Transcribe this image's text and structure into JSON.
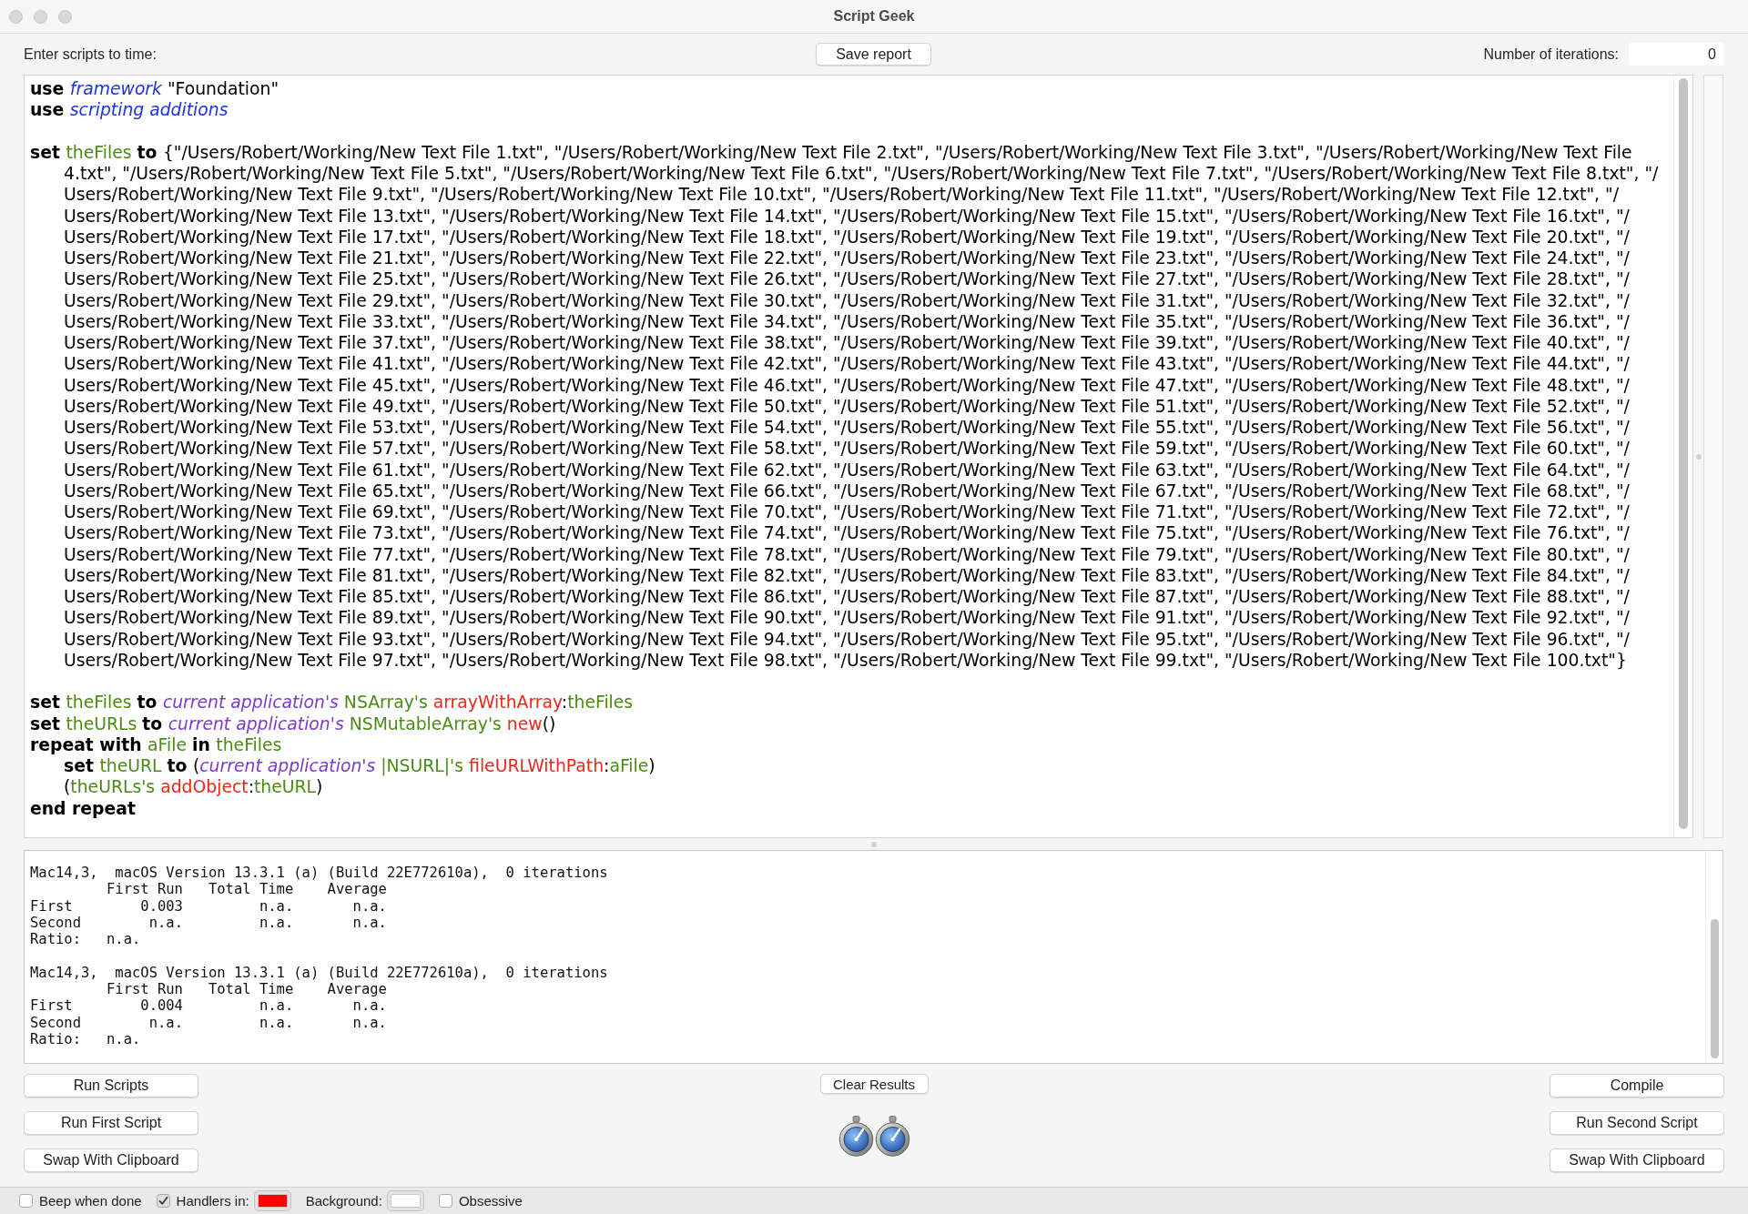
{
  "window": {
    "title": "Script Geek"
  },
  "toolbar": {
    "prompt": "Enter scripts to time:",
    "save_button": "Save report",
    "iterations": {
      "label": "Number of iterations:",
      "value": "0"
    }
  },
  "editor": {
    "lines": [
      {
        "kind": "code",
        "tokens": [
          {
            "kind": "keyword",
            "text": "use "
          },
          {
            "kind": "term",
            "text": "framework "
          },
          {
            "kind": "text",
            "text": "\"Foundation\""
          }
        ]
      },
      {
        "kind": "code",
        "tokens": [
          {
            "kind": "keyword",
            "text": "use "
          },
          {
            "kind": "term",
            "text": "scripting additions"
          }
        ]
      },
      {
        "kind": "blank"
      },
      {
        "kind": "code",
        "tokens": [
          {
            "kind": "keyword",
            "text": "set "
          },
          {
            "kind": "variable",
            "text": "theFiles "
          },
          {
            "kind": "keyword",
            "text": "to "
          },
          {
            "kind": "text",
            "text": "{\"/Users/Robert/Working/New Text File 1.txt\", \"/Users/Robert/Working/New Text File 2.txt\", \"/Users/Robert/Working/New Text File 3.txt\", \"/Users/Robert/Working/New Text File"
          }
        ],
        "continuation": [
          "4.txt\", \"/Users/Robert/Working/New Text File 5.txt\", \"/Users/Robert/Working/New Text File 6.txt\", \"/Users/Robert/Working/New Text File 7.txt\", \"/Users/Robert/Working/New Text File 8.txt\", \"/",
          "Users/Robert/Working/New Text File 9.txt\", \"/Users/Robert/Working/New Text File 10.txt\", \"/Users/Robert/Working/New Text File 11.txt\", \"/Users/Robert/Working/New Text File 12.txt\", \"/",
          "Users/Robert/Working/New Text File 13.txt\", \"/Users/Robert/Working/New Text File 14.txt\", \"/Users/Robert/Working/New Text File 15.txt\", \"/Users/Robert/Working/New Text File 16.txt\", \"/",
          "Users/Robert/Working/New Text File 17.txt\", \"/Users/Robert/Working/New Text File 18.txt\", \"/Users/Robert/Working/New Text File 19.txt\", \"/Users/Robert/Working/New Text File 20.txt\", \"/",
          "Users/Robert/Working/New Text File 21.txt\", \"/Users/Robert/Working/New Text File 22.txt\", \"/Users/Robert/Working/New Text File 23.txt\", \"/Users/Robert/Working/New Text File 24.txt\", \"/",
          "Users/Robert/Working/New Text File 25.txt\", \"/Users/Robert/Working/New Text File 26.txt\", \"/Users/Robert/Working/New Text File 27.txt\", \"/Users/Robert/Working/New Text File 28.txt\", \"/",
          "Users/Robert/Working/New Text File 29.txt\", \"/Users/Robert/Working/New Text File 30.txt\", \"/Users/Robert/Working/New Text File 31.txt\", \"/Users/Robert/Working/New Text File 32.txt\", \"/",
          "Users/Robert/Working/New Text File 33.txt\", \"/Users/Robert/Working/New Text File 34.txt\", \"/Users/Robert/Working/New Text File 35.txt\", \"/Users/Robert/Working/New Text File 36.txt\", \"/",
          "Users/Robert/Working/New Text File 37.txt\", \"/Users/Robert/Working/New Text File 38.txt\", \"/Users/Robert/Working/New Text File 39.txt\", \"/Users/Robert/Working/New Text File 40.txt\", \"/",
          "Users/Robert/Working/New Text File 41.txt\", \"/Users/Robert/Working/New Text File 42.txt\", \"/Users/Robert/Working/New Text File 43.txt\", \"/Users/Robert/Working/New Text File 44.txt\", \"/",
          "Users/Robert/Working/New Text File 45.txt\", \"/Users/Robert/Working/New Text File 46.txt\", \"/Users/Robert/Working/New Text File 47.txt\", \"/Users/Robert/Working/New Text File 48.txt\", \"/",
          "Users/Robert/Working/New Text File 49.txt\", \"/Users/Robert/Working/New Text File 50.txt\", \"/Users/Robert/Working/New Text File 51.txt\", \"/Users/Robert/Working/New Text File 52.txt\", \"/",
          "Users/Robert/Working/New Text File 53.txt\", \"/Users/Robert/Working/New Text File 54.txt\", \"/Users/Robert/Working/New Text File 55.txt\", \"/Users/Robert/Working/New Text File 56.txt\", \"/",
          "Users/Robert/Working/New Text File 57.txt\", \"/Users/Robert/Working/New Text File 58.txt\", \"/Users/Robert/Working/New Text File 59.txt\", \"/Users/Robert/Working/New Text File 60.txt\", \"/",
          "Users/Robert/Working/New Text File 61.txt\", \"/Users/Robert/Working/New Text File 62.txt\", \"/Users/Robert/Working/New Text File 63.txt\", \"/Users/Robert/Working/New Text File 64.txt\", \"/",
          "Users/Robert/Working/New Text File 65.txt\", \"/Users/Robert/Working/New Text File 66.txt\", \"/Users/Robert/Working/New Text File 67.txt\", \"/Users/Robert/Working/New Text File 68.txt\", \"/",
          "Users/Robert/Working/New Text File 69.txt\", \"/Users/Robert/Working/New Text File 70.txt\", \"/Users/Robert/Working/New Text File 71.txt\", \"/Users/Robert/Working/New Text File 72.txt\", \"/",
          "Users/Robert/Working/New Text File 73.txt\", \"/Users/Robert/Working/New Text File 74.txt\", \"/Users/Robert/Working/New Text File 75.txt\", \"/Users/Robert/Working/New Text File 76.txt\", \"/",
          "Users/Robert/Working/New Text File 77.txt\", \"/Users/Robert/Working/New Text File 78.txt\", \"/Users/Robert/Working/New Text File 79.txt\", \"/Users/Robert/Working/New Text File 80.txt\", \"/",
          "Users/Robert/Working/New Text File 81.txt\", \"/Users/Robert/Working/New Text File 82.txt\", \"/Users/Robert/Working/New Text File 83.txt\", \"/Users/Robert/Working/New Text File 84.txt\", \"/",
          "Users/Robert/Working/New Text File 85.txt\", \"/Users/Robert/Working/New Text File 86.txt\", \"/Users/Robert/Working/New Text File 87.txt\", \"/Users/Robert/Working/New Text File 88.txt\", \"/",
          "Users/Robert/Working/New Text File 89.txt\", \"/Users/Robert/Working/New Text File 90.txt\", \"/Users/Robert/Working/New Text File 91.txt\", \"/Users/Robert/Working/New Text File 92.txt\", \"/",
          "Users/Robert/Working/New Text File 93.txt\", \"/Users/Robert/Working/New Text File 94.txt\", \"/Users/Robert/Working/New Text File 95.txt\", \"/Users/Robert/Working/New Text File 96.txt\", \"/",
          "Users/Robert/Working/New Text File 97.txt\", \"/Users/Robert/Working/New Text File 98.txt\", \"/Users/Robert/Working/New Text File 99.txt\", \"/Users/Robert/Working/New Text File 100.txt\"}"
        ]
      },
      {
        "kind": "blank"
      },
      {
        "kind": "code",
        "tokens": [
          {
            "kind": "keyword",
            "text": "set "
          },
          {
            "kind": "variable",
            "text": "theFiles "
          },
          {
            "kind": "keyword",
            "text": "to "
          },
          {
            "kind": "application",
            "text": "current application's "
          },
          {
            "kind": "variable",
            "text": "NSArray's "
          },
          {
            "kind": "handler",
            "text": "arrayWithArray"
          },
          {
            "kind": "text",
            "text": ":"
          },
          {
            "kind": "variable",
            "text": "theFiles"
          }
        ]
      },
      {
        "kind": "code",
        "tokens": [
          {
            "kind": "keyword",
            "text": "set "
          },
          {
            "kind": "variable",
            "text": "theURLs "
          },
          {
            "kind": "keyword",
            "text": "to "
          },
          {
            "kind": "application",
            "text": "current application's "
          },
          {
            "kind": "variable",
            "text": "NSMutableArray's "
          },
          {
            "kind": "handler",
            "text": "new"
          },
          {
            "kind": "text",
            "text": "()"
          }
        ]
      },
      {
        "kind": "code",
        "tokens": [
          {
            "kind": "keyword",
            "text": "repeat with "
          },
          {
            "kind": "variable",
            "text": "aFile "
          },
          {
            "kind": "keyword",
            "text": "in "
          },
          {
            "kind": "variable",
            "text": "theFiles"
          }
        ],
        "children": [
          {
            "kind": "code",
            "tokens": [
              {
                "kind": "keyword",
                "text": "set "
              },
              {
                "kind": "variable",
                "text": "theURL "
              },
              {
                "kind": "keyword",
                "text": "to "
              },
              {
                "kind": "text",
                "text": "("
              },
              {
                "kind": "application",
                "text": "current application's "
              },
              {
                "kind": "variable",
                "text": "|NSURL|'s "
              },
              {
                "kind": "handler",
                "text": "fileURLWithPath"
              },
              {
                "kind": "text",
                "text": ":"
              },
              {
                "kind": "variable",
                "text": "aFile"
              },
              {
                "kind": "text",
                "text": ")"
              }
            ]
          },
          {
            "kind": "code",
            "tokens": [
              {
                "kind": "text",
                "text": "("
              },
              {
                "kind": "variable",
                "text": "theURLs's "
              },
              {
                "kind": "handler",
                "text": "addObject"
              },
              {
                "kind": "text",
                "text": ":"
              },
              {
                "kind": "variable",
                "text": "theURL"
              },
              {
                "kind": "text",
                "text": ")"
              }
            ]
          }
        ]
      },
      {
        "kind": "code",
        "tokens": [
          {
            "kind": "keyword",
            "text": "end repeat"
          }
        ]
      }
    ]
  },
  "results": {
    "reports": [
      {
        "header": "Mac14,3,  macOS Version 13.3.1 (a) (Build 22E772610a),  0 iterations",
        "columns": [
          "First Run",
          "Total Time",
          "Average"
        ],
        "rows": [
          {
            "label": "First",
            "values": [
              "0.003",
              "n.a.",
              "n.a."
            ]
          },
          {
            "label": "Second",
            "values": [
              "n.a.",
              "n.a.",
              "n.a."
            ]
          }
        ],
        "ratio": {
          "label": "Ratio:",
          "value": "n.a."
        }
      },
      {
        "header": "Mac14,3,  macOS Version 13.3.1 (a) (Build 22E772610a),  0 iterations",
        "columns": [
          "First Run",
          "Total Time",
          "Average"
        ],
        "rows": [
          {
            "label": "First",
            "values": [
              "0.004",
              "n.a.",
              "n.a."
            ]
          },
          {
            "label": "Second",
            "values": [
              "n.a.",
              "n.a.",
              "n.a."
            ]
          }
        ],
        "ratio": {
          "label": "Ratio:",
          "value": "n.a."
        }
      }
    ]
  },
  "buttons": {
    "left": [
      "Run Scripts",
      "Run First Script",
      "Swap With Clipboard"
    ],
    "center": "Clear Results",
    "right": [
      "Compile",
      "Run Second Script",
      "Swap With Clipboard"
    ]
  },
  "status_bar": {
    "items": [
      {
        "kind": "checkbox",
        "label": "Beep when done",
        "checked": false
      },
      {
        "kind": "checkbox",
        "label": "Handlers in:",
        "checked": true
      },
      {
        "kind": "color_well",
        "color": "#ff0000"
      },
      {
        "kind": "label",
        "text": "Background:"
      },
      {
        "kind": "color_well",
        "color": "#ffffff"
      },
      {
        "kind": "checkbox",
        "label": "Obsessive",
        "checked": false
      }
    ]
  }
}
